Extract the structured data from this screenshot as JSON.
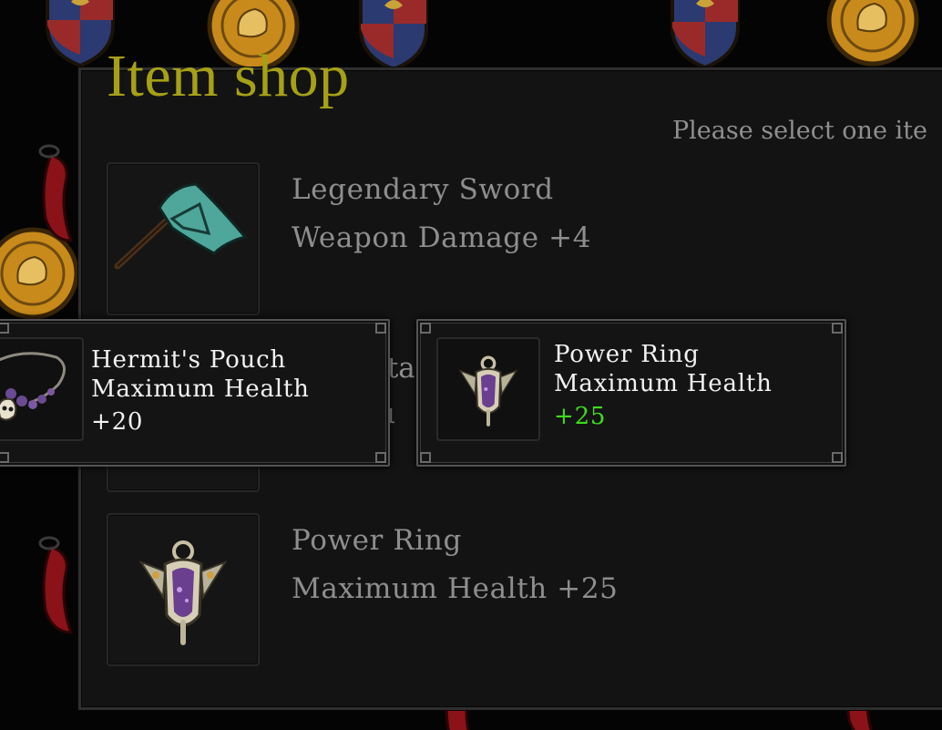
{
  "shop": {
    "title": "Item shop",
    "hint": "Please select one ite"
  },
  "items": [
    {
      "name": "Legendary Sword",
      "effect": "Weapon Damage +4",
      "icon": "axe-icon"
    },
    {
      "peek_a": "rta",
      "peek_b": "u",
      "icon": "item-icon"
    },
    {
      "name": "Power Ring",
      "effect": "Maximum Health +25",
      "icon": "amulet-icon"
    }
  ],
  "tooltips": [
    {
      "name": "Hermit's Pouch",
      "stat": "Maximum Health",
      "value": "+20",
      "icon": "skull-necklace-icon",
      "value_color": "#f2f2f2"
    },
    {
      "name": "Power Ring",
      "stat": "Maximum Health",
      "value": "+25",
      "icon": "amulet-icon",
      "value_color": "#3fdc1e"
    }
  ],
  "colors": {
    "title": "#a6a016",
    "text_muted": "#8e8e8e",
    "bonus_green": "#3fdc1e",
    "panel": "#131313"
  }
}
